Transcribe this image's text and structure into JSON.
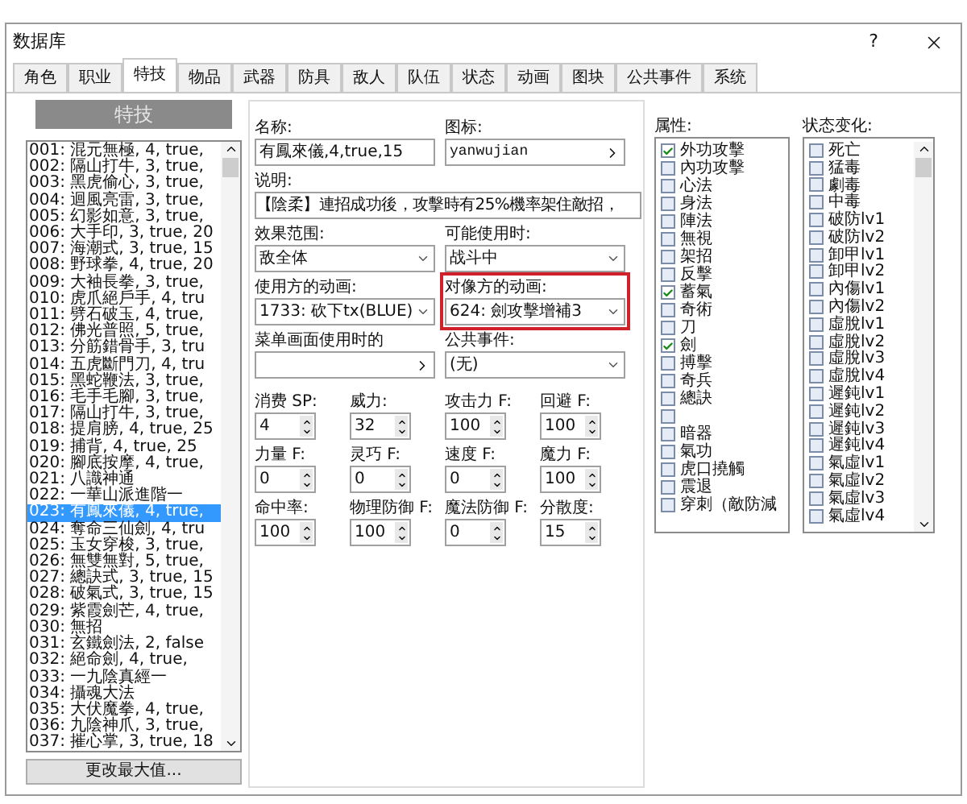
{
  "window": {
    "title": "数据库",
    "help": "?"
  },
  "tabs": [
    {
      "label": "角色",
      "selected": false
    },
    {
      "label": "职业",
      "selected": false
    },
    {
      "label": "特技",
      "selected": true
    },
    {
      "label": "物品",
      "selected": false
    },
    {
      "label": "武器",
      "selected": false
    },
    {
      "label": "防具",
      "selected": false
    },
    {
      "label": "敌人",
      "selected": false
    },
    {
      "label": "队伍",
      "selected": false
    },
    {
      "label": "状态",
      "selected": false
    },
    {
      "label": "动画",
      "selected": false
    },
    {
      "label": "图块",
      "selected": false
    },
    {
      "label": "公共事件",
      "selected": false
    },
    {
      "label": "系统",
      "selected": false
    }
  ],
  "skill_list": {
    "header": "特技",
    "items": [
      {
        "text": "001: 混元無極, 4, true,",
        "selected": false
      },
      {
        "text": "002: 隔山打牛, 3, true,",
        "selected": false
      },
      {
        "text": "003: 黑虎偷心, 3, true,",
        "selected": false
      },
      {
        "text": "004: 迴風亮雷, 3, true,",
        "selected": false
      },
      {
        "text": "005: 幻影如意, 3, true,",
        "selected": false
      },
      {
        "text": "006: 大手印, 3, true, 20",
        "selected": false
      },
      {
        "text": "007: 海潮式, 3, true, 15",
        "selected": false
      },
      {
        "text": "008: 野球拳, 4, true, 20",
        "selected": false
      },
      {
        "text": "009: 大袖長拳, 3, true,",
        "selected": false
      },
      {
        "text": "010: 虎爪絕戶手, 4, tru",
        "selected": false
      },
      {
        "text": "011: 劈石破玉, 4, true,",
        "selected": false
      },
      {
        "text": "012: 佛光普照, 5, true,",
        "selected": false
      },
      {
        "text": "013: 分筋錯骨手, 3, tru",
        "selected": false
      },
      {
        "text": "014: 五虎斷門刀, 4, tru",
        "selected": false
      },
      {
        "text": "015: 黑蛇鞭法, 3, true,",
        "selected": false
      },
      {
        "text": "016: 毛手毛腳, 3, true,",
        "selected": false
      },
      {
        "text": "017: 隔山打牛, 3, true,",
        "selected": false
      },
      {
        "text": "018: 提肩膀, 4, true, 25",
        "selected": false
      },
      {
        "text": "019: 捕背, 4, true, 25",
        "selected": false
      },
      {
        "text": "020: 腳底按摩, 4, true,",
        "selected": false
      },
      {
        "text": "021: 八識神通",
        "selected": false
      },
      {
        "text": "022: 一華山派進階一",
        "selected": false
      },
      {
        "text": "023: 有鳳來儀, 4, true,",
        "selected": true
      },
      {
        "text": "024: 奪命三仙劍, 4, tru",
        "selected": false
      },
      {
        "text": "025: 玉女穿梭, 3, true,",
        "selected": false
      },
      {
        "text": "026: 無雙無對, 5, true,",
        "selected": false
      },
      {
        "text": "027: 總訣式, 3, true, 15",
        "selected": false
      },
      {
        "text": "028: 破氣式, 3, true, 15",
        "selected": false
      },
      {
        "text": "029: 紫霞劍芒, 4, true,",
        "selected": false
      },
      {
        "text": "030: 無招",
        "selected": false
      },
      {
        "text": "031: 玄鐵劍法, 2, false",
        "selected": false
      },
      {
        "text": "032: 絕命劍, 4, true,",
        "selected": false
      },
      {
        "text": "033: 一九陰真經一",
        "selected": false
      },
      {
        "text": "034: 攝魂大法",
        "selected": false
      },
      {
        "text": "035: 大伏魔拳, 4, true,",
        "selected": false
      },
      {
        "text": "036: 九陰神爪, 3, true,",
        "selected": false
      },
      {
        "text": "037: 摧心掌, 3, true, 18",
        "selected": false
      }
    ],
    "button": "更改最大值..."
  },
  "form": {
    "name": {
      "label": "名称:",
      "value": "有鳳來儀,4,true,15"
    },
    "icon": {
      "label": "图标:",
      "value": "yanwujian"
    },
    "description": {
      "label": "说明:",
      "value": "【陰柔】連招成功後，攻擊時有25%機率架住敵招，"
    },
    "selects": [
      {
        "label": "效果范围:",
        "value": "敌全体",
        "highlighted": false
      },
      {
        "label": "可能使用时:",
        "value": "战斗中",
        "highlighted": false
      },
      {
        "label": "使用方的动画:",
        "value": "1733: 砍下tx(BLUE)",
        "highlighted": false
      },
      {
        "label": "对像方的动画:",
        "value": "624: 劍攻擊增補3",
        "highlighted": true
      }
    ],
    "menu_animation": {
      "label": "菜单画面使用时的"
    },
    "common_event": {
      "label": "公共事件:",
      "value": "(无)"
    },
    "params": [
      {
        "label": "消费 SP:",
        "value": "4"
      },
      {
        "label": "威力:",
        "value": "32"
      },
      {
        "label": "攻击力 F:",
        "value": "100"
      },
      {
        "label": "回避 F:",
        "value": "100"
      },
      {
        "label": "力量 F:",
        "value": "0"
      },
      {
        "label": "灵巧 F:",
        "value": "0"
      },
      {
        "label": "速度 F:",
        "value": "0"
      },
      {
        "label": "魔力 F:",
        "value": "100"
      },
      {
        "label": "命中率:",
        "value": "100"
      },
      {
        "label": "物理防御 F:",
        "value": "100"
      },
      {
        "label": "魔法防御 F:",
        "value": "0"
      },
      {
        "label": "分散度:",
        "value": "15"
      }
    ]
  },
  "attributes": {
    "label": "属性:",
    "items": [
      {
        "text": "外功攻擊",
        "checked": true
      },
      {
        "text": "內功攻擊",
        "checked": false
      },
      {
        "text": "心法",
        "checked": false
      },
      {
        "text": "身法",
        "checked": false
      },
      {
        "text": "陣法",
        "checked": false
      },
      {
        "text": "無視",
        "checked": false
      },
      {
        "text": "架招",
        "checked": false
      },
      {
        "text": "反擊",
        "checked": false
      },
      {
        "text": "蓄氣",
        "checked": true
      },
      {
        "text": "奇術",
        "checked": false
      },
      {
        "text": "刀",
        "checked": false
      },
      {
        "text": "劍",
        "checked": true
      },
      {
        "text": "搏擊",
        "checked": false
      },
      {
        "text": "奇兵",
        "checked": false
      },
      {
        "text": "總訣",
        "checked": false
      },
      {
        "checked": false
      },
      {
        "text": "暗器",
        "checked": false
      },
      {
        "text": "氣功",
        "checked": false
      },
      {
        "text": "虎口撓觸",
        "checked": false
      },
      {
        "text": "震退",
        "checked": false
      },
      {
        "text": "穿刺（敵防減",
        "checked": false
      }
    ]
  },
  "states": {
    "label": "状态变化:",
    "items": [
      {
        "text": "死亡",
        "checked": false
      },
      {
        "text": "猛毒",
        "checked": false
      },
      {
        "text": "劇毒",
        "checked": false
      },
      {
        "text": "中毒",
        "checked": false
      },
      {
        "text": "破防lv1",
        "checked": false
      },
      {
        "text": "破防lv2",
        "checked": false
      },
      {
        "text": "卸甲lv1",
        "checked": false
      },
      {
        "text": "卸甲lv2",
        "checked": false
      },
      {
        "text": "內傷lv1",
        "checked": false
      },
      {
        "text": "內傷lv2",
        "checked": false
      },
      {
        "text": "虛脫lv1",
        "checked": false
      },
      {
        "text": "虛脫lv2",
        "checked": false
      },
      {
        "text": "虛脫lv3",
        "checked": false
      },
      {
        "text": "虛脫lv4",
        "checked": false
      },
      {
        "text": "遲鈍lv1",
        "checked": false
      },
      {
        "text": "遲鈍lv2",
        "checked": false
      },
      {
        "text": "遲鈍lv3",
        "checked": false
      },
      {
        "text": "遲鈍lv4",
        "checked": false
      },
      {
        "text": "氣虛lv1",
        "checked": false
      },
      {
        "text": "氣虛lv2",
        "checked": false
      },
      {
        "text": "氣虛lv3",
        "checked": false
      },
      {
        "text": "氣虛lv4",
        "checked": false
      }
    ]
  }
}
